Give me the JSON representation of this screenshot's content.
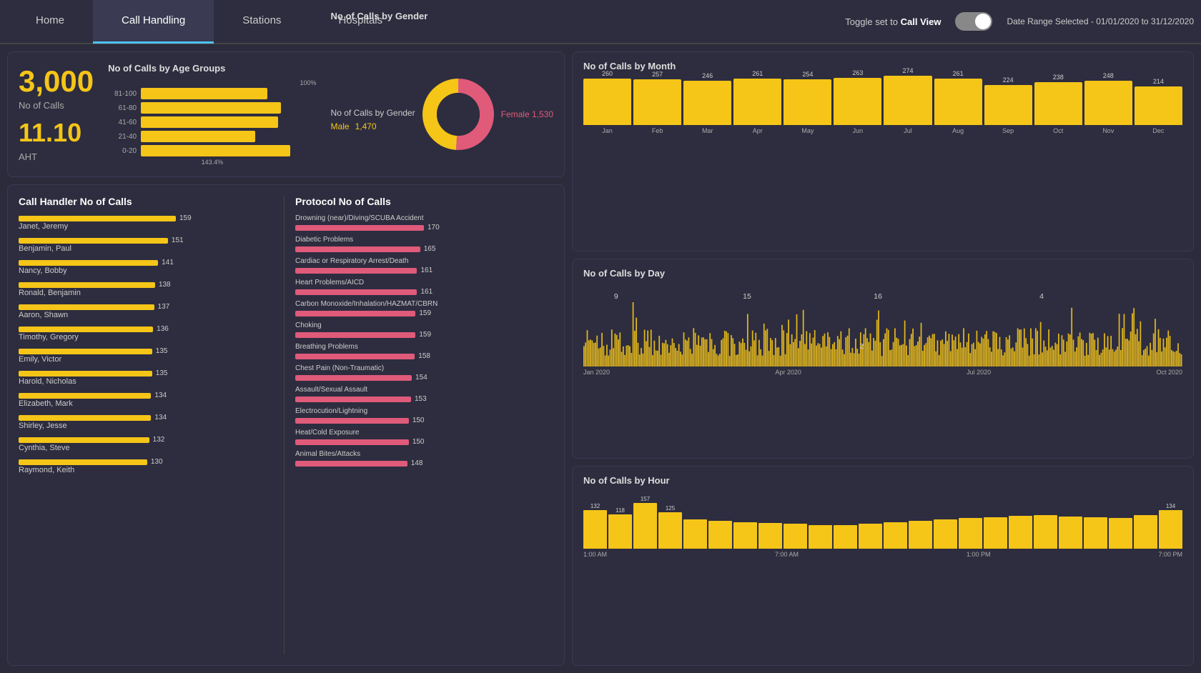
{
  "nav": {
    "tabs": [
      "Home",
      "Call Handling",
      "Stations",
      "Hospitals"
    ],
    "active_tab": "Call Handling",
    "toggle_label": "Toggle set to",
    "toggle_view": "Call View",
    "date_range": "Date Range Selected - 01/01/2020 to 31/12/2020"
  },
  "summary": {
    "calls_label": "No of Calls",
    "calls_value": "3,000",
    "aht_value": "11.10",
    "aht_label": "AHT"
  },
  "age_groups": {
    "title": "No of Calls by Age Groups",
    "pct_max": "100%",
    "pct_bottom": "143.4%",
    "bars": [
      {
        "label": "81-100",
        "pct": 72
      },
      {
        "label": "61-80",
        "pct": 80
      },
      {
        "label": "41-60",
        "pct": 78
      },
      {
        "label": "21-40",
        "pct": 65
      },
      {
        "label": "0-20",
        "pct": 85
      }
    ]
  },
  "gender": {
    "title": "No of Calls by Gender",
    "male_label": "Male",
    "male_value": "1,470",
    "female_label": "Female",
    "female_value": "1,530",
    "male_pct": 49,
    "female_pct": 51
  },
  "call_handler": {
    "title": "Call Handler No of Calls",
    "max_val": 159,
    "rows": [
      {
        "name": "Janet, Jeremy",
        "val": 159
      },
      {
        "name": "Benjamin, Paul",
        "val": 151
      },
      {
        "name": "Nancy, Bobby",
        "val": 141
      },
      {
        "name": "Ronald, Benjamin",
        "val": 138
      },
      {
        "name": "Aaron, Shawn",
        "val": 137
      },
      {
        "name": "Timothy, Gregory",
        "val": 136
      },
      {
        "name": "Emily, Victor",
        "val": 135
      },
      {
        "name": "Harold, Nicholas",
        "val": 135
      },
      {
        "name": "Elizabeth, Mark",
        "val": 134
      },
      {
        "name": "Shirley, Jesse",
        "val": 134
      },
      {
        "name": "Cynthia, Steve",
        "val": 132
      },
      {
        "name": "Raymond, Keith",
        "val": 130
      }
    ]
  },
  "protocol": {
    "title": "Protocol No of Calls",
    "max_val": 170,
    "rows": [
      {
        "name": "Drowning (near)/Diving/SCUBA Accident",
        "val": 170
      },
      {
        "name": "Diabetic Problems",
        "val": 165
      },
      {
        "name": "Cardiac or Respiratory Arrest/Death",
        "val": 161
      },
      {
        "name": "Heart Problems/AICD",
        "val": 161
      },
      {
        "name": "Carbon Monoxide/Inhalation/HAZMAT/CBRN",
        "val": 159
      },
      {
        "name": "Choking",
        "val": 159
      },
      {
        "name": "Breathing Problems",
        "val": 158
      },
      {
        "name": "Chest Pain (Non-Traumatic)",
        "val": 154
      },
      {
        "name": "Assault/Sexual Assault",
        "val": 153
      },
      {
        "name": "Electrocution/Lightning",
        "val": 150
      },
      {
        "name": "Heat/Cold Exposure",
        "val": 150
      },
      {
        "name": "Animal Bites/Attacks",
        "val": 148
      }
    ]
  },
  "calls_by_month": {
    "title": "No of Calls by Month",
    "months": [
      {
        "label": "Jan",
        "val": 260
      },
      {
        "label": "Feb",
        "val": 257
      },
      {
        "label": "Mar",
        "val": 246
      },
      {
        "label": "Apr",
        "val": 261
      },
      {
        "label": "May",
        "val": 254
      },
      {
        "label": "Jun",
        "val": 263
      },
      {
        "label": "Jul",
        "val": 274
      },
      {
        "label": "Aug",
        "val": 261
      },
      {
        "label": "Sep",
        "val": 224
      },
      {
        "label": "Oct",
        "val": 238
      },
      {
        "label": "Nov",
        "val": 248
      },
      {
        "label": "Dec",
        "val": 214
      }
    ],
    "max": 280
  },
  "calls_by_day": {
    "title": "No of Calls by Day",
    "labels": [
      "Jan 2020",
      "Apr 2020",
      "Jul 2020",
      "Oct 2020"
    ],
    "peak_labels": [
      "9",
      "15",
      "16",
      "4"
    ],
    "min_label": "2"
  },
  "calls_by_hour": {
    "title": "No of Calls by Hour",
    "axis": [
      "1:00 AM",
      "7:00 AM",
      "1:00 PM",
      "7:00 PM"
    ],
    "hours": [
      {
        "label": "132",
        "val": 132,
        "show_label": true
      },
      {
        "label": "118",
        "val": 118,
        "show_label": true
      },
      {
        "label": "157",
        "val": 157,
        "show_label": true
      },
      {
        "label": "125",
        "val": 125,
        "show_label": true
      },
      {
        "label": "",
        "val": 100,
        "show_label": false
      },
      {
        "label": "",
        "val": 95,
        "show_label": false
      },
      {
        "label": "",
        "val": 90,
        "show_label": false
      },
      {
        "label": "",
        "val": 88,
        "show_label": false
      },
      {
        "label": "",
        "val": 85,
        "show_label": false
      },
      {
        "label": "",
        "val": 82,
        "show_label": false
      },
      {
        "label": "",
        "val": 80,
        "show_label": false
      },
      {
        "label": "",
        "val": 85,
        "show_label": false
      },
      {
        "label": "",
        "val": 90,
        "show_label": false
      },
      {
        "label": "",
        "val": 95,
        "show_label": false
      },
      {
        "label": "",
        "val": 100,
        "show_label": false
      },
      {
        "label": "",
        "val": 105,
        "show_label": false
      },
      {
        "label": "",
        "val": 108,
        "show_label": false
      },
      {
        "label": "",
        "val": 112,
        "show_label": false
      },
      {
        "label": "",
        "val": 115,
        "show_label": false
      },
      {
        "label": "",
        "val": 110,
        "show_label": false
      },
      {
        "label": "",
        "val": 108,
        "show_label": false
      },
      {
        "label": "",
        "val": 105,
        "show_label": false
      },
      {
        "label": "",
        "val": 115,
        "show_label": false
      },
      {
        "label": "134",
        "val": 134,
        "show_label": true
      }
    ],
    "max": 160
  }
}
